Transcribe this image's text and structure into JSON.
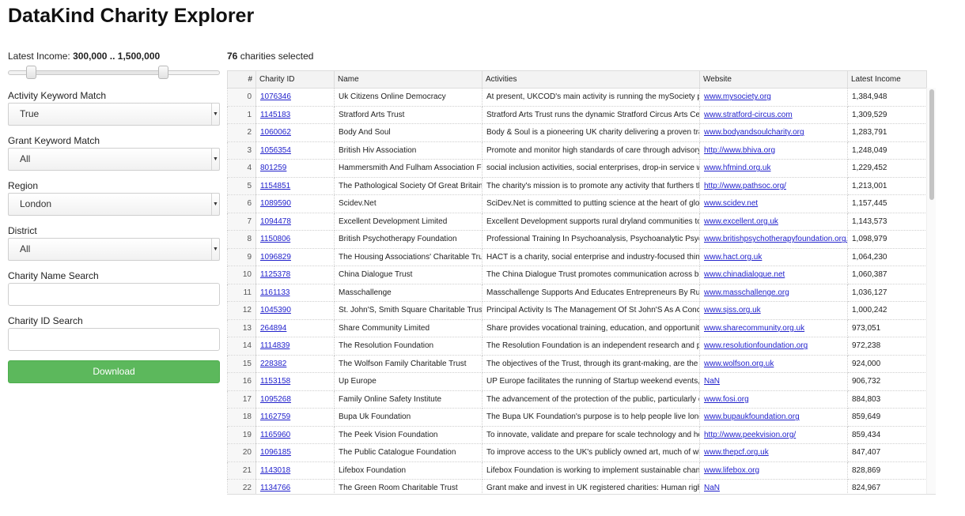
{
  "app": {
    "title": "DataKind Charity Explorer"
  },
  "filters": {
    "income_label": "Latest Income:",
    "income_range": "300,000 .. 1,500,000",
    "income_slider": {
      "min_fraction": 0.11,
      "max_fraction": 0.74
    },
    "activity": {
      "label": "Activity Keyword Match",
      "value": "True"
    },
    "grant": {
      "label": "Grant Keyword Match",
      "value": "All"
    },
    "region": {
      "label": "Region",
      "value": "London"
    },
    "district": {
      "label": "District",
      "value": "All"
    },
    "name_search": {
      "label": "Charity Name Search",
      "value": ""
    },
    "id_search": {
      "label": "Charity ID Search",
      "value": ""
    },
    "download_label": "Download"
  },
  "summary": {
    "count": "76",
    "suffix": "charities selected"
  },
  "table": {
    "columns": [
      "#",
      "Charity ID",
      "Name",
      "Activities",
      "Website",
      "Latest Income"
    ],
    "rows": [
      [
        "0",
        "1076346",
        "Uk Citizens Online Democracy",
        "At present, UKCOD's main activity is running the mySociety project",
        "www.mysociety.org",
        "1,384,948"
      ],
      [
        "1",
        "1145183",
        "Stratford Arts Trust",
        "Stratford Arts Trust runs the dynamic Stratford Circus Arts Centre",
        "www.stratford-circus.com",
        "1,309,529"
      ],
      [
        "2",
        "1060062",
        "Body And Soul",
        "Body & Soul is a pioneering UK charity delivering a proven transformative",
        "www.bodyandsoulcharity.org",
        "1,283,791"
      ],
      [
        "3",
        "1056354",
        "British Hiv Association",
        "Promote and monitor high standards of care through advisory groups",
        "http://www.bhiva.org",
        "1,248,049"
      ],
      [
        "4",
        "801259",
        "Hammersmith And Fulham Association For Mental Health",
        "social inclusion activities, social enterprises, drop-in service with",
        "www.hfmind.org.uk",
        "1,229,452"
      ],
      [
        "5",
        "1154851",
        "The Pathological Society Of Great Britain And Ireland",
        "The charity's mission is to promote any activity that furthers the",
        "http://www.pathsoc.org/",
        "1,213,001"
      ],
      [
        "6",
        "1089590",
        "Scidev.Net",
        "SciDev.Net is committed to putting science at the heart of global development",
        "www.scidev.net",
        "1,157,445"
      ],
      [
        "7",
        "1094478",
        "Excellent Development Limited",
        "Excellent Development supports rural dryland communities to work",
        "www.excellent.org.uk",
        "1,143,573"
      ],
      [
        "8",
        "1150806",
        "British Psychotherapy Foundation",
        "Professional Training In Psychoanalysis, Psychoanalytic Psychotherapy",
        "www.britishpsychotherapyfoundation.org.uk",
        "1,098,979"
      ],
      [
        "9",
        "1096829",
        "The Housing Associations' Charitable Trust",
        "HACT is a charity, social enterprise and industry-focused think/do tank",
        "www.hact.org.uk",
        "1,064,230"
      ],
      [
        "10",
        "1125378",
        "China Dialogue Trust",
        "The China Dialogue Trust promotes communication across barriers",
        "www.chinadialogue.net",
        "1,060,387"
      ],
      [
        "11",
        "1161133",
        "Masschallenge",
        "Masschallenge Supports And Educates Entrepreneurs By Running",
        "www.masschallenge.org",
        "1,036,127"
      ],
      [
        "12",
        "1045390",
        "St. John'S, Smith Square Charitable Trust",
        "Principal Activity Is The Management Of St John'S As A Concert Hall",
        "www.sjss.org.uk",
        "1,000,242"
      ],
      [
        "13",
        "264894",
        "Share Community Limited",
        "Share provides vocational training, education, and opportunities for",
        "www.sharecommunity.org.uk",
        "973,051"
      ],
      [
        "14",
        "1114839",
        "The Resolution Foundation",
        "The Resolution Foundation is an independent research and policy",
        "www.resolutionfoundation.org",
        "972,238"
      ],
      [
        "15",
        "228382",
        "The Wolfson Family Charitable Trust",
        "The objectives of the Trust, through its grant-making, are the advancement",
        "www.wolfson.org.uk",
        "924,000"
      ],
      [
        "16",
        "1153158",
        "Up Europe",
        "UP Europe facilitates the running of Startup weekend events, and",
        "NaN",
        "906,732"
      ],
      [
        "17",
        "1095268",
        "Family Online Safety Institute",
        "The advancement of the protection of the public, particularly children",
        "www.fosi.org",
        "884,803"
      ],
      [
        "18",
        "1162759",
        "Bupa Uk Foundation",
        "The Bupa UK Foundation's purpose is to help people live longer,",
        "www.bupaukfoundation.org",
        "859,649"
      ],
      [
        "19",
        "1165960",
        "The Peek Vision Foundation",
        "To innovate, validate and prepare for scale technology and health",
        "http://www.peekvision.org/",
        "859,434"
      ],
      [
        "20",
        "1096185",
        "The Public Catalogue Foundation",
        "To improve access to the UK's publicly owned art, much of which",
        "www.thepcf.org.uk",
        "847,407"
      ],
      [
        "21",
        "1143018",
        "Lifebox Foundation",
        "Lifebox Foundation is working to implement sustainable changes",
        "www.lifebox.org",
        "828,869"
      ],
      [
        "22",
        "1134766",
        "The Green Room Charitable Trust",
        "Grant make and invest in UK registered charities: Human rights,",
        "NaN",
        "824,967"
      ]
    ]
  }
}
